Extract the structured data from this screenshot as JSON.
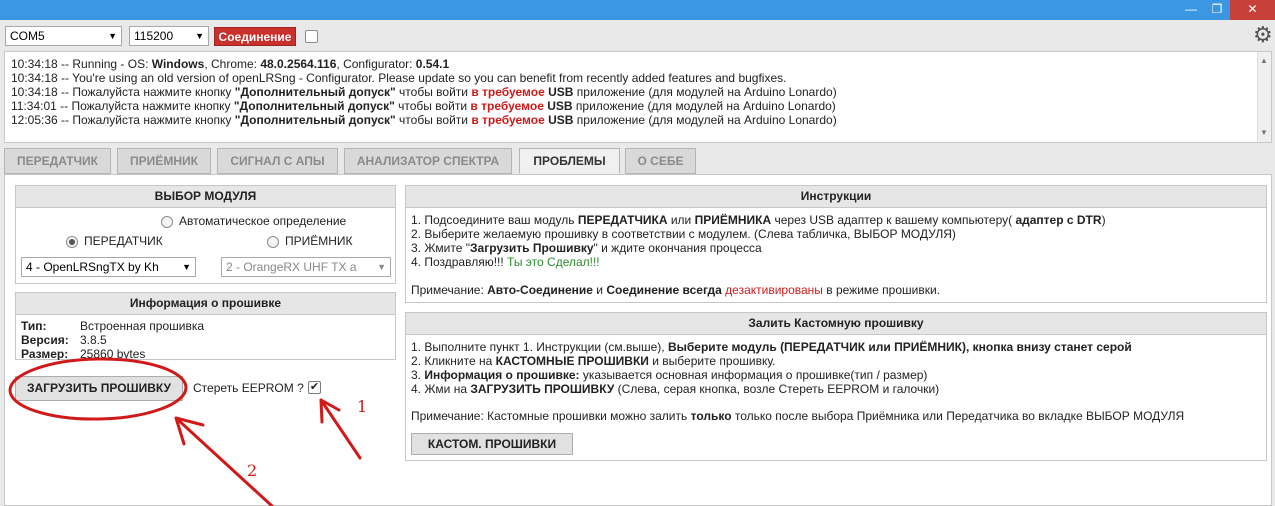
{
  "window": {
    "minimize": "—",
    "maximize": "❐",
    "close": "✕"
  },
  "toolbar": {
    "port": "COM5",
    "baud": "115200",
    "connect_label": "Соединение"
  },
  "log": {
    "lines": [
      {
        "time": "10:34:18",
        "a": " -- Running - OS: ",
        "b": "Windows",
        "c": ", Chrome: ",
        "d": "48.0.2564.116",
        "e": ", Configurator: ",
        "f": "0.54.1"
      },
      {
        "time": "10:34:18",
        "text": " -- You're using an old version of openLRSng - Configurator. Please update so you can benefit from recently added features and bugfixes."
      },
      {
        "time": "10:34:18"
      },
      {
        "time": "11:34:01"
      },
      {
        "time": "12:05:36"
      }
    ],
    "press_prefix": " -- Пожалуйста нажмите кнопку ",
    "press_button": "\"Дополнительный допуск\"",
    "press_mid": " чтобы войти ",
    "press_red": "в требуемое",
    "press_usb": "USB",
    "press_suffix": " приложение (для модулей на Arduino Lonardo)"
  },
  "tabs": [
    {
      "label": "ПЕРЕДАТЧИК"
    },
    {
      "label": "ПРИЁМНИК"
    },
    {
      "label": "СИГНАЛ С АПЫ"
    },
    {
      "label": "АНАЛИЗАТОР СПЕКТРА"
    },
    {
      "label": "ПРОБЛЕМЫ"
    },
    {
      "label": "О СЕБЕ"
    }
  ],
  "module_select": {
    "title": "ВЫБОР МОДУЛЯ",
    "auto_label": "Автоматическое определение",
    "tx_label": "ПЕРЕДАТЧИК",
    "rx_label": "ПРИЁМНИК",
    "tx_firmware": "4 - OpenLRSngTX by Kh",
    "rx_firmware": "2 - OrangeRX UHF TX a"
  },
  "firmware_info": {
    "title": "Информация о прошивке",
    "type_key": "Тип:",
    "type_val": "Встроенная прошивка",
    "version_key": "Версия:",
    "version_val": "3.8.5",
    "size_key": "Размер:",
    "size_val": "25860 bytes"
  },
  "flash": {
    "button": "ЗАГРУЗИТЬ ПРОШИВКУ",
    "erase_label": "Стереть EEPROM ?"
  },
  "instructions": {
    "title": "Инструкции",
    "l1a": "1. Подсоедините ваш модуль ",
    "l1b": "ПЕРЕДАТЧИКА",
    "l1c": " или ",
    "l1d": "ПРИЁМНИКА",
    "l1e": " через USB адаптер к вашему компьютеру( ",
    "l1f": "адаптер с DTR",
    "l1g": ")",
    "l2": "2. Выберите желаемую прошивку в соответствии с модулем. (Слева табличка, ВЫБОР МОДУЛЯ)",
    "l3a": "3. Жмите \"",
    "l3b": "Загрузить Прошивку",
    "l3c": "\" и ждите окончания процесса",
    "l4a": "4. Поздравляю!!! ",
    "l4b": "Ты это Сделал!!!",
    "note_a": "Примечание: ",
    "note_b": "Авто-Соединение",
    "note_c": " и ",
    "note_d": "Соединение всегда",
    "note_e": " ",
    "note_f": "дезактивированы",
    "note_g": " в режиме прошивки."
  },
  "custom": {
    "title": "Залить Кастомную прошивку",
    "l1a": "1. Выполните пункт 1. Инструкции (см.выше), ",
    "l1b": "Выберите модуль (ПЕРЕДАТЧИК или ПРИЁМНИК), кнопка внизу станет серой",
    "l2a": "2. Кликните на ",
    "l2b": "КАСТОМНЫЕ ПРОШИВКИ",
    "l2c": " и выберите прошивку.",
    "l3a": "3. ",
    "l3b": "Информация о прошивке:",
    "l3c": " указывается основная информация о прошивке(тип / размер)",
    "l4a": "4. Жми на ",
    "l4b": "ЗАГРУЗИТЬ ПРОШИВКУ",
    "l4c": " (Слева, серая кнопка, возле Стереть EEPROM и галочки)",
    "note_a": "Примечание: Кастомные прошивки можно залить ",
    "note_b": "только",
    "note_c": " только после выбора Приёмника или Передатчика во вкладке ВЫБОР МОДУЛЯ",
    "button": "КАСТОМ. ПРОШИВКИ"
  },
  "annotations": {
    "n1": "1",
    "n2": "2"
  },
  "colors": {
    "titlebar": "#3c97e3",
    "connect": "#c9302c",
    "annotation": "#d01a1a"
  }
}
